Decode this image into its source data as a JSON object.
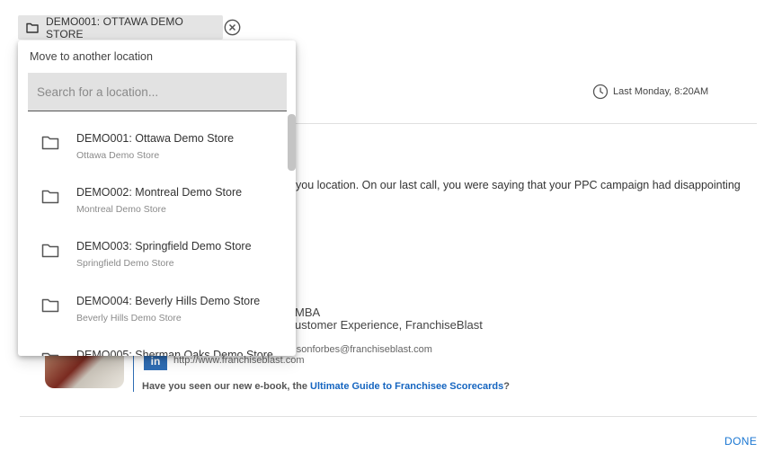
{
  "location_chip": {
    "label": "DEMO001: OTTAWA DEMO STORE",
    "folder_icon": "folder-icon",
    "close_icon": "clear-circle-icon"
  },
  "dropdown": {
    "title": "Move to another location",
    "search_placeholder": "Search for a location...",
    "items": [
      {
        "name": "DEMO001: Ottawa Demo Store",
        "sub": "Ottawa Demo Store"
      },
      {
        "name": "DEMO002: Montreal Demo Store",
        "sub": "Montreal Demo Store"
      },
      {
        "name": "DEMO003: Springfield Demo Store",
        "sub": "Springfield Demo Store"
      },
      {
        "name": "DEMO004: Beverly Hills Demo Store",
        "sub": "Beverly Hills Demo Store"
      },
      {
        "name": "DEMO005: Sherman Oaks Demo Store",
        "sub": ""
      }
    ]
  },
  "message": {
    "timestamp": "Last Monday, 8:20AM",
    "body_visible": "you location. On our last call, you were saying that your PPC campaign had disappointing",
    "signature": {
      "name_fragment": "MBA",
      "title_fragment": "ustomer Experience, FranchiseBlast",
      "email_fragment": "rdsonforbes@franchiseblast.com",
      "url": "http://www.franchiseblast.com",
      "linkedin_label": "in",
      "promo_prefix": "Have you seen our new e-book, the ",
      "promo_link": "Ultimate Guide to Franchisee Scorecards",
      "promo_suffix": "?"
    }
  },
  "actions": {
    "done_label": "DONE"
  },
  "colors": {
    "accent": "#1976d2",
    "link": "#1565c0",
    "chip_bg": "#e4e4e4",
    "search_bg": "#e2e2e2"
  }
}
